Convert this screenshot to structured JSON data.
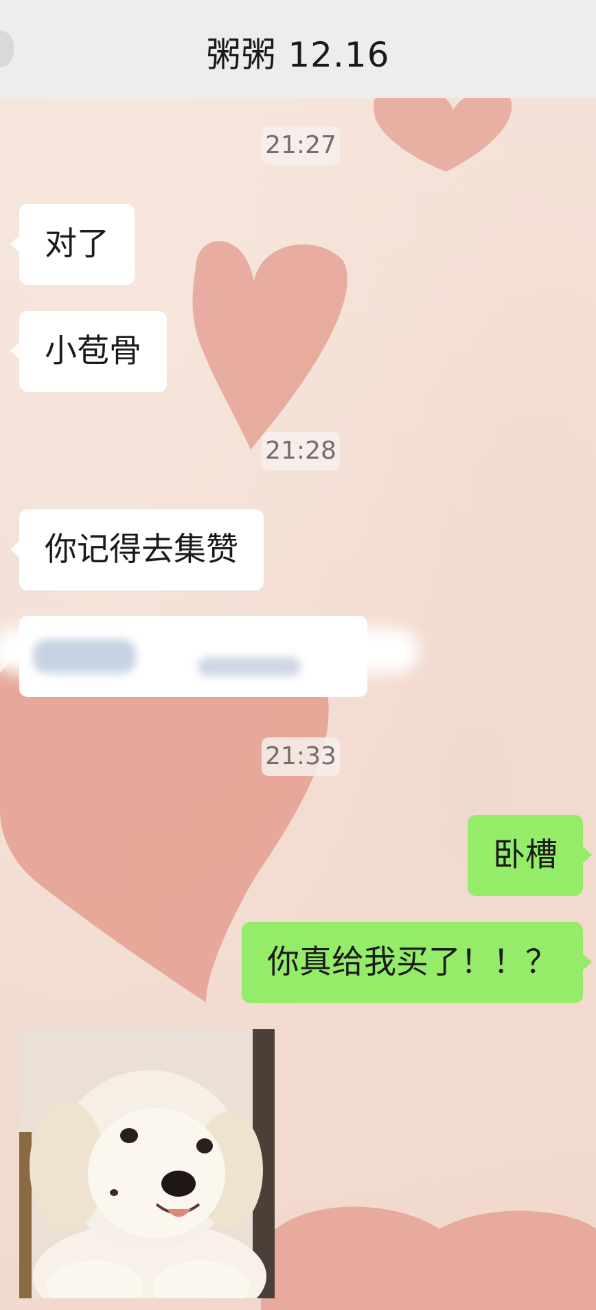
{
  "header": {
    "title": "粥粥 12.16"
  },
  "messages": [
    {
      "type": "time",
      "text": "21:27"
    },
    {
      "type": "in",
      "text": "对了"
    },
    {
      "type": "in",
      "text": "小苞骨"
    },
    {
      "type": "time",
      "text": "21:28"
    },
    {
      "type": "in",
      "text": "你记得去集赞"
    },
    {
      "type": "in-redacted",
      "text": ""
    },
    {
      "type": "time",
      "text": "21:33"
    },
    {
      "type": "out",
      "text": "卧槽"
    },
    {
      "type": "out",
      "text": "你真给我买了！！？"
    },
    {
      "type": "in-sticker",
      "icon": "puppy-sticker-icon"
    }
  ],
  "colors": {
    "incoming_bubble": "#ffffff",
    "outgoing_bubble": "#95ec69",
    "topbar": "#ededed",
    "heart": "#e39a8c"
  }
}
